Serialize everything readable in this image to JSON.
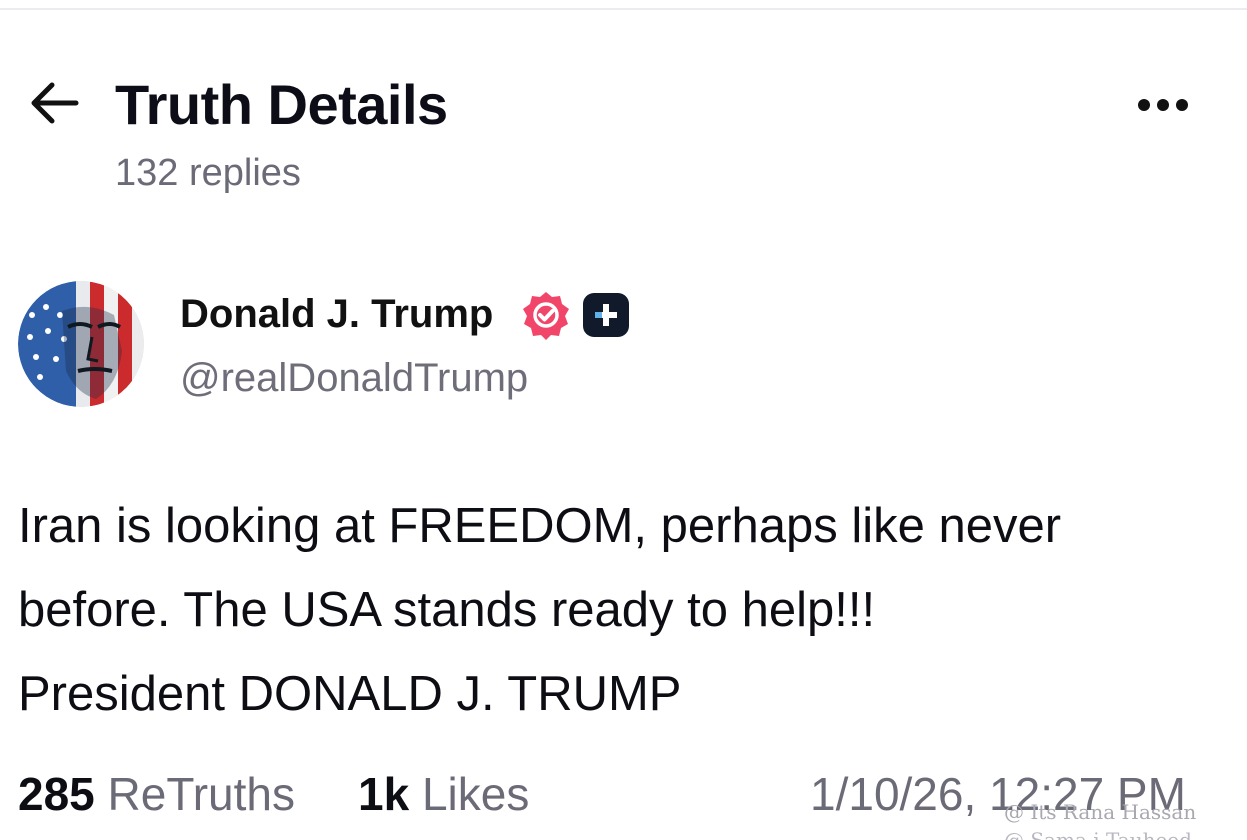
{
  "header": {
    "title": "Truth Details",
    "reply_count": "132 replies",
    "back_icon": "arrow-left-icon",
    "more_icon": "more-horizontal-icon"
  },
  "post": {
    "author": {
      "name": "Donald J. Trump",
      "handle": "@realDonaldTrump",
      "verified_icon": "verified-badge-icon",
      "verified_color": "#f2456a",
      "plus_icon": "plus-badge-icon"
    },
    "text_lines": [
      "Iran is looking at FREEDOM, perhaps like never",
      "before. The USA stands ready to help!!!",
      "President DONALD J. TRUMP"
    ],
    "stats": {
      "retruths_count": "285",
      "retruths_label": "ReTruths",
      "likes_count": "1k",
      "likes_label": "Likes"
    },
    "timestamp": "1/10/26, 12:27 PM"
  },
  "watermark": {
    "line1": "@ Its Rana Hassan",
    "line2": "@ Sama i Tauheed"
  }
}
